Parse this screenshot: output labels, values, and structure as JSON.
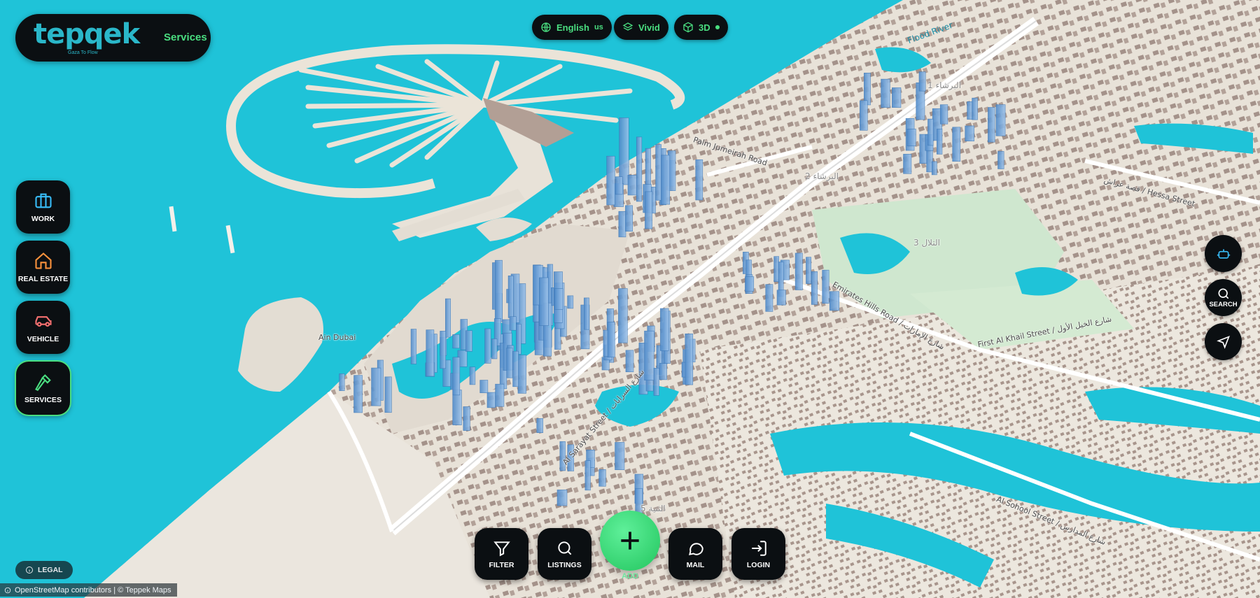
{
  "brand": {
    "logo": "tepqek",
    "tagline": "Gaza To Flow",
    "section": "Services"
  },
  "top_controls": {
    "language": {
      "label": "English",
      "code": "us",
      "icon": "globe-icon"
    },
    "style": {
      "label": "Vivid",
      "icon": "layers-icon"
    },
    "view": {
      "label": "3D",
      "icon": "cube-icon"
    }
  },
  "categories": [
    {
      "label": "WORK",
      "icon": "briefcase-icon",
      "color": "#38bdf8"
    },
    {
      "label": "REAL ESTATE",
      "icon": "home-icon",
      "color": "#fb923c"
    },
    {
      "label": "VEHICLE",
      "icon": "car-icon",
      "color": "#f87171"
    },
    {
      "label": "SERVICES",
      "icon": "hammer-icon",
      "color": "#4ade80"
    }
  ],
  "right_controls": [
    {
      "label": "",
      "icon": "robot-icon"
    },
    {
      "label": "SEARCH",
      "icon": "search-icon"
    },
    {
      "label": "",
      "icon": "navigation-arrow-icon"
    }
  ],
  "bottom_bar": {
    "filter": "FILTER",
    "listings": "LISTINGS",
    "add": "ADD",
    "mail": "MAIL",
    "login": "LOGIN"
  },
  "legal": "LEGAL",
  "attribution": "OpenStreetMap contributors | © Teppek Maps",
  "map_labels": {
    "palm_road": "Palm Jumeirah Road",
    "hessa": "قصة عراش / Hessa Street",
    "emirates_hills": "Emirates Hills Road / شارع الإمارات",
    "first_al_khail": "First Al Khail Street / شارع الخيل الأول",
    "sarayat": "Al Sarayat Street / شارع السرايات",
    "school": "Al Sohool Street / شارع المدارس",
    "ain_dubai": "Ain Dubai",
    "district_1": "البرشاء 1",
    "district_2": "البرشاء 2",
    "district_3": "التلال 3",
    "district_5": "الثنية 5",
    "river": "Flood River"
  },
  "colors": {
    "water": "#1fc3d8",
    "land": "#e9e4dc",
    "building": "#a08d82",
    "tower": "#6fa8dc",
    "accent": "#4ade80",
    "button_bg": "#0b0f12"
  }
}
